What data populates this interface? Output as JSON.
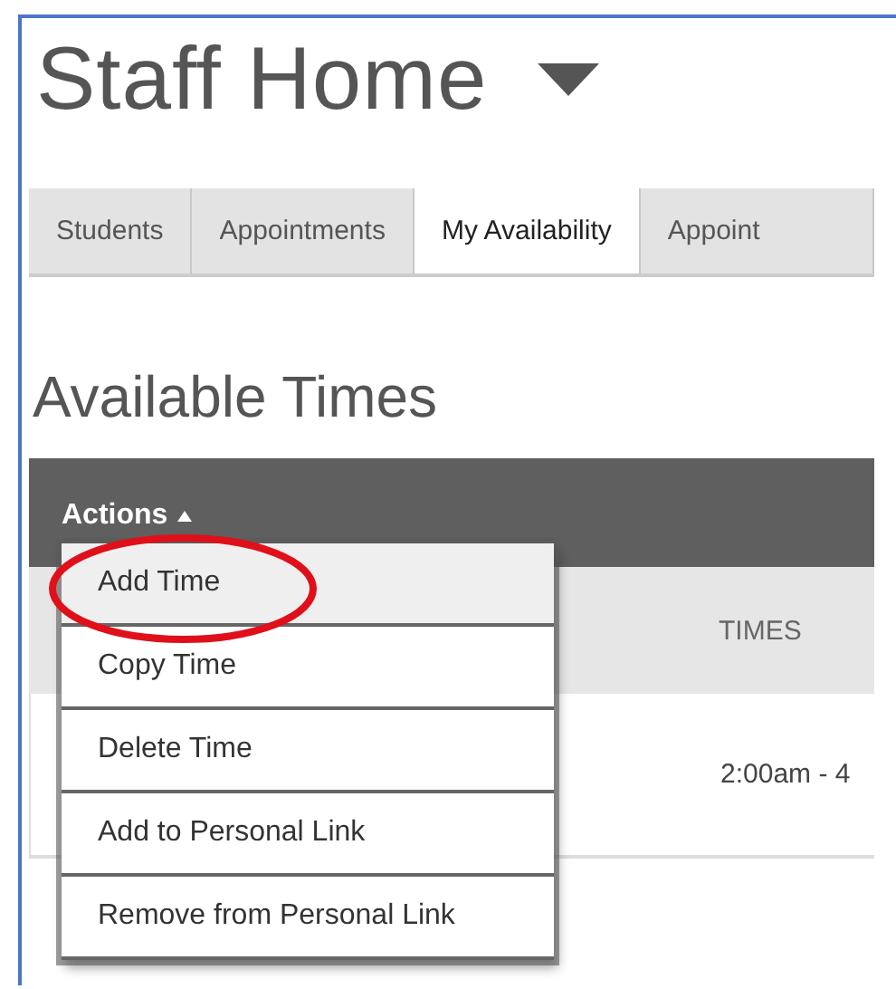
{
  "page_title": "Staff Home",
  "tabs": [
    {
      "label": "Students",
      "selected": false
    },
    {
      "label": "Appointments",
      "selected": false
    },
    {
      "label": "My Availability",
      "selected": true
    },
    {
      "label": "Appoint",
      "selected": false
    }
  ],
  "section_title": "Available Times",
  "actions_menu": {
    "label": "Actions",
    "expanded": true,
    "items": [
      {
        "label": "Add Time",
        "highlighted": true,
        "circled": true
      },
      {
        "label": "Copy Time",
        "highlighted": false,
        "circled": false
      },
      {
        "label": "Delete Time",
        "highlighted": false,
        "circled": false
      },
      {
        "label": "Add to Personal Link",
        "highlighted": false,
        "circled": false
      },
      {
        "label": "Remove from Personal Link",
        "highlighted": false,
        "circled": false
      }
    ]
  },
  "table": {
    "columns": [
      "TIMES"
    ],
    "rows": [
      [
        "2:00am - 4"
      ]
    ]
  }
}
